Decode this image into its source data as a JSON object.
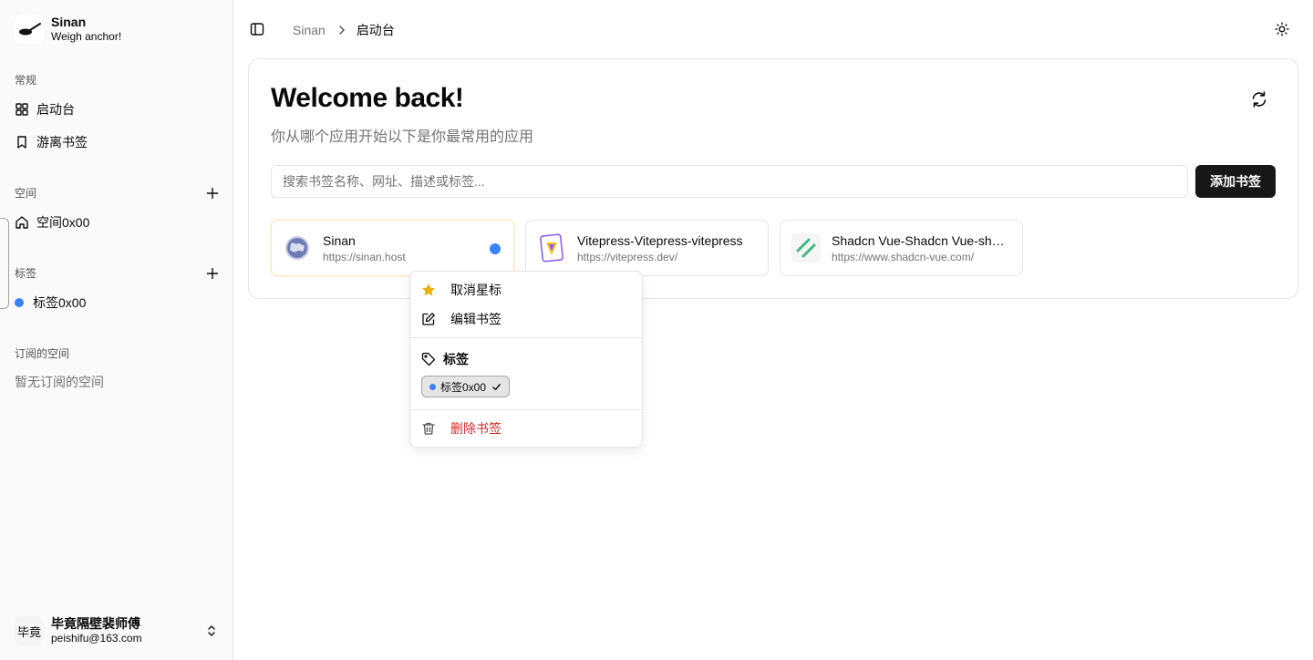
{
  "brand": {
    "name": "Sinan",
    "tagline": "Weigh anchor!"
  },
  "sidebar": {
    "groups": {
      "general": {
        "label": "常规",
        "items": [
          {
            "label": "启动台",
            "icon": "grid-icon"
          },
          {
            "label": "游离书签",
            "icon": "bookmark-icon"
          }
        ]
      },
      "spaces": {
        "label": "空间",
        "items": [
          {
            "label": "空间0x00",
            "icon": "home-icon"
          }
        ]
      },
      "tags": {
        "label": "标签",
        "items": [
          {
            "label": "标签0x00",
            "color": "#3b82f6"
          }
        ]
      },
      "subscribed": {
        "label": "订阅的空间",
        "empty": "暂无订阅的空间"
      }
    }
  },
  "user": {
    "avatar_text": "毕竟",
    "name": "毕竟隔壁裴师傅",
    "email": "peishifu@163.com"
  },
  "header": {
    "breadcrumb": [
      "Sinan",
      "启动台"
    ]
  },
  "main": {
    "title": "Welcome back!",
    "subtitle": "你从哪个应用开始以下是你最常用的应用",
    "search_placeholder": "搜索书签名称、网址、描述或标签...",
    "add_button": "添加书签",
    "bookmarks": [
      {
        "name": "Sinan",
        "url": "https://sinan.host",
        "starred": true,
        "tag_color": "#3b82f6"
      },
      {
        "name": "Vitepress-Vitepress-vitepress",
        "url": "https://vitepress.dev/"
      },
      {
        "name": "Shadcn Vue-Shadcn Vue-shadcn",
        "url": "https://www.shadcn-vue.com/"
      }
    ]
  },
  "context_menu": {
    "unstar": "取消星标",
    "edit": "编辑书签",
    "tags_header": "标签",
    "tag_chip": "标签0x00",
    "delete": "删除书签"
  },
  "colors": {
    "accent": "#3b82f6",
    "primary": "#171717",
    "danger": "#dc2626",
    "star": "#eab308"
  }
}
